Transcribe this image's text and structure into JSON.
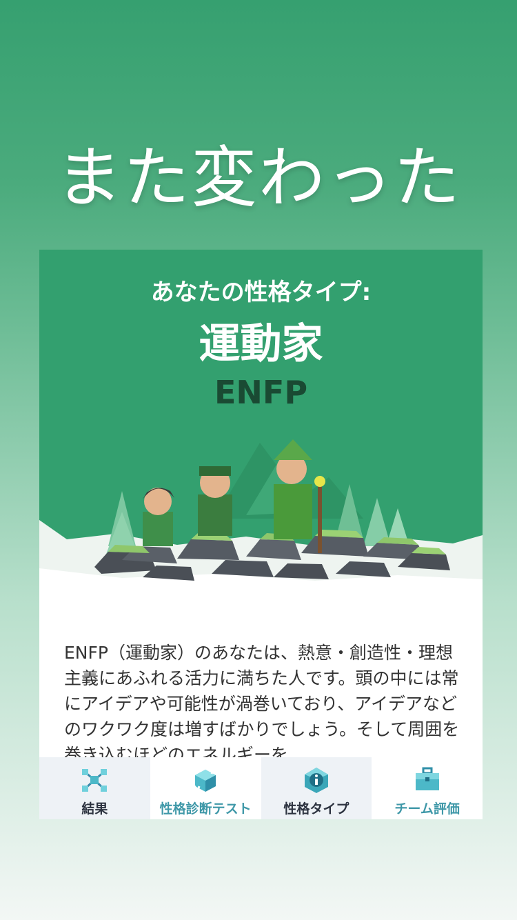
{
  "headline": "また変わった",
  "card": {
    "type_label": "あなたの性格タイプ:",
    "type_name": "運動家",
    "type_code": "ENFP",
    "description": "ENFP（運動家）のあなたは、熱意・創造性・理想主義にあふれる活力に満ちた人です。頭の中には常にアイデアや可能性が渦巻いており、アイデアなどのワクワク度は増すばかりでしょう。そして周囲を巻き込むほどのエネルギーを"
  },
  "tabs": [
    {
      "label": "結果",
      "icon": "molecule-icon"
    },
    {
      "label": "性格診断テスト",
      "icon": "cube-arrows-icon"
    },
    {
      "label": "性格タイプ",
      "icon": "info-gem-icon"
    },
    {
      "label": "チーム評価",
      "icon": "briefcase-icon"
    }
  ],
  "colors": {
    "card_green": "#33a06f",
    "type_code": "#1a4a33",
    "tab_teal": "#3f98a8",
    "tab_dark": "#2d3340"
  }
}
